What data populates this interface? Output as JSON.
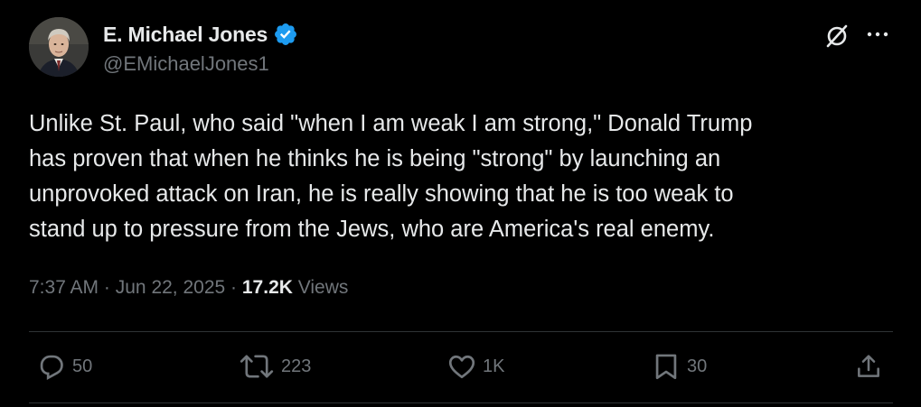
{
  "author": {
    "name": "E. Michael Jones",
    "handle": "@EMichaelJones1",
    "verified": true
  },
  "tweet": {
    "lines": [
      "Unlike St. Paul, who said \"when I am weak I am strong,\" Donald Trump",
      "has proven that when he thinks he is being \"strong\" by launching an",
      "unprovoked attack on Iran, he is really showing that he is too weak to",
      "stand up to pressure from the Jews, who are America's real enemy."
    ],
    "time": "7:37 AM",
    "separator": "·",
    "date": "Jun 22, 2025",
    "views_count": "17.2K",
    "views_label": "Views"
  },
  "actions": {
    "replies": "50",
    "reposts": "223",
    "likes": "1K",
    "bookmarks": "30"
  },
  "icons": {
    "verified": "verified-badge-icon",
    "grok": "grok-icon",
    "more": "more-icon",
    "reply": "reply-icon",
    "repost": "repost-icon",
    "like": "heart-icon",
    "bookmark": "bookmark-icon",
    "share": "share-icon"
  },
  "colors": {
    "background": "#000000",
    "text": "#e7e9ea",
    "secondary": "#71767b",
    "verified": "#1d9bf0",
    "divider": "#2f3336"
  }
}
